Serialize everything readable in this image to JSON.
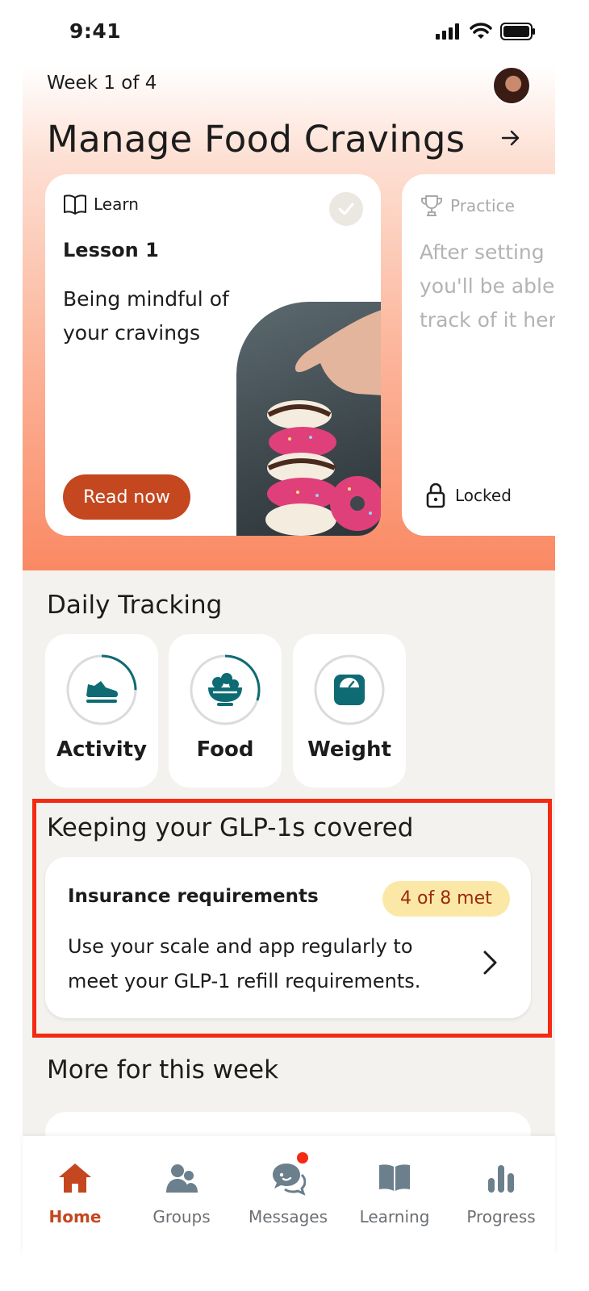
{
  "status_bar": {
    "time": "9:41"
  },
  "header": {
    "week_label": "Week 1 of 4",
    "title": "Manage Food Cravings"
  },
  "learn_card": {
    "tag": "Learn",
    "lesson": "Lesson 1",
    "description": "Being mindful of your cravings",
    "button_label": "Read now",
    "completed": true
  },
  "practice_card": {
    "tag": "Practice",
    "description_lines": [
      "After setting",
      "you'll be able",
      "track of it her"
    ],
    "status": "Locked"
  },
  "daily_tracking": {
    "title": "Daily Tracking",
    "items": [
      {
        "label": "Activity",
        "icon": "shoe-icon",
        "progress": 0.25
      },
      {
        "label": "Food",
        "icon": "salad-bowl-icon",
        "progress": 0.3
      },
      {
        "label": "Weight",
        "icon": "scale-icon",
        "progress": 0
      }
    ]
  },
  "glp": {
    "title": "Keeping your GLP-1s covered",
    "card_title": "Insurance requirements",
    "badge": "4 of 8 met",
    "description": "Use your scale and app regularly to meet your GLP-1 refill requirements."
  },
  "more": {
    "title": "More for this week"
  },
  "nav": {
    "items": [
      {
        "label": "Home",
        "icon": "home-icon",
        "active": true
      },
      {
        "label": "Groups",
        "icon": "groups-icon",
        "active": false
      },
      {
        "label": "Messages",
        "icon": "messages-icon",
        "active": false,
        "notification": true
      },
      {
        "label": "Learning",
        "icon": "book-icon",
        "active": false
      },
      {
        "label": "Progress",
        "icon": "bar-chart-icon",
        "active": false
      }
    ]
  },
  "colors": {
    "accent": "#c4471f",
    "teal": "#0e6b73",
    "badge_bg": "#fbe8a6",
    "highlight": "#f42a12"
  }
}
